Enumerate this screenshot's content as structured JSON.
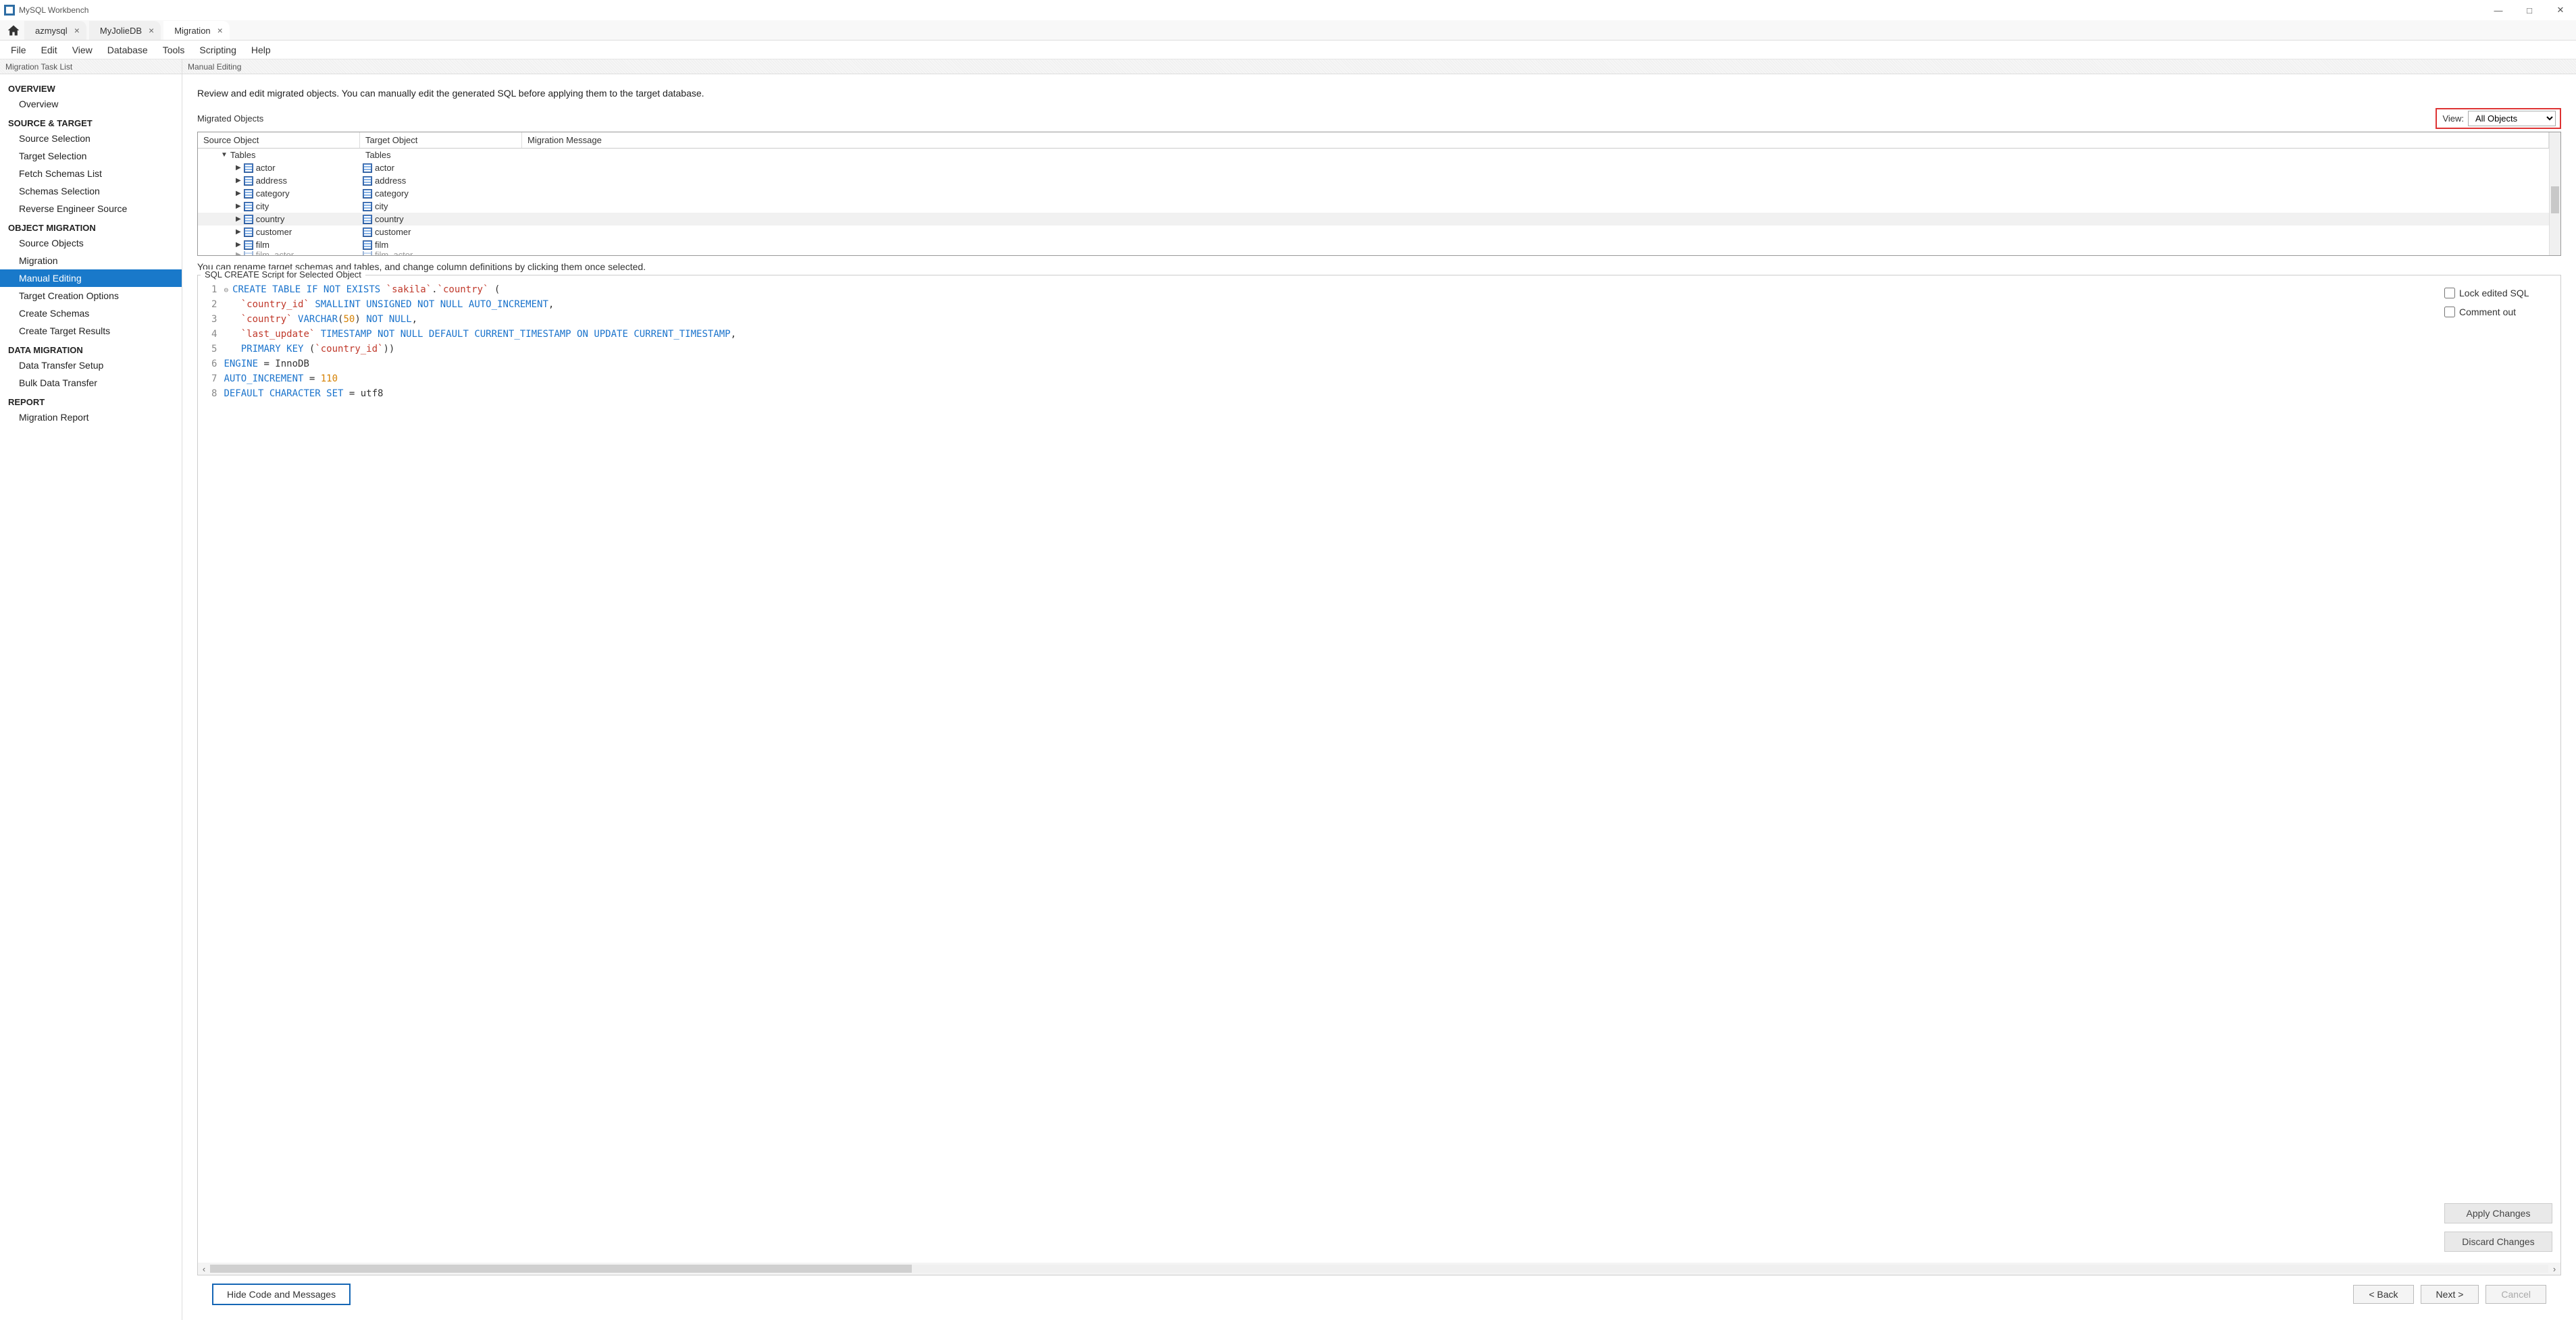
{
  "app": {
    "title": "MySQL Workbench"
  },
  "tabs": [
    {
      "label": "azmysql",
      "active": false
    },
    {
      "label": "MyJolieDB",
      "active": false
    },
    {
      "label": "Migration",
      "active": true
    }
  ],
  "menu": [
    "File",
    "Edit",
    "View",
    "Database",
    "Tools",
    "Scripting",
    "Help"
  ],
  "sidebar": {
    "header": "Migration Task List",
    "sections": [
      {
        "title": "OVERVIEW",
        "items": [
          "Overview"
        ]
      },
      {
        "title": "SOURCE & TARGET",
        "items": [
          "Source Selection",
          "Target Selection",
          "Fetch Schemas List",
          "Schemas Selection",
          "Reverse Engineer Source"
        ]
      },
      {
        "title": "OBJECT MIGRATION",
        "items": [
          "Source Objects",
          "Migration",
          "Manual Editing",
          "Target Creation Options",
          "Create Schemas",
          "Create Target Results"
        ]
      },
      {
        "title": "DATA MIGRATION",
        "items": [
          "Data Transfer Setup",
          "Bulk Data Transfer"
        ]
      },
      {
        "title": "REPORT",
        "items": [
          "Migration Report"
        ]
      }
    ],
    "active": "Manual Editing"
  },
  "main": {
    "header": "Manual Editing",
    "instructions": "Review and edit migrated objects. You can manually edit the generated SQL before applying them to the target database.",
    "migrated_label": "Migrated Objects",
    "view_label": "View:",
    "view_value": "All Objects",
    "columns": {
      "src": "Source Object",
      "tgt": "Target Object",
      "msg": "Migration Message"
    },
    "group": {
      "src": "Tables",
      "tgt": "Tables"
    },
    "rows": [
      {
        "src": "actor",
        "tgt": "actor"
      },
      {
        "src": "address",
        "tgt": "address"
      },
      {
        "src": "category",
        "tgt": "category"
      },
      {
        "src": "city",
        "tgt": "city"
      },
      {
        "src": "country",
        "tgt": "country",
        "selected": true
      },
      {
        "src": "customer",
        "tgt": "customer"
      },
      {
        "src": "film",
        "tgt": "film"
      },
      {
        "src": "film_actor",
        "tgt": "film_actor"
      }
    ],
    "hint": "You can rename target schemas and tables, and change column definitions by clicking them once selected.",
    "sql_title": "SQL CREATE Script for Selected Object",
    "lock_label": "Lock edited SQL",
    "comment_label": "Comment out",
    "apply": "Apply Changes",
    "discard": "Discard Changes",
    "toggle": "Hide Code and Messages",
    "back": "< Back",
    "next": "Next >",
    "cancel": "Cancel"
  },
  "sql": {
    "l1a": "CREATE TABLE IF NOT EXISTS",
    "l1b": "`sakila`",
    "l1c": ".",
    "l1d": "`country`",
    "l1e": " (",
    "l2a": "`country_id`",
    "l2b": " SMALLINT UNSIGNED NOT NULL AUTO_INCREMENT",
    "l2c": ",",
    "l3a": "`country`",
    "l3b": " VARCHAR",
    "l3c": "(",
    "l3d": "50",
    "l3e": ")",
    "l3f": " NOT NULL",
    "l3g": ",",
    "l4a": "`last_update`",
    "l4b": " TIMESTAMP NOT NULL DEFAULT CURRENT_TIMESTAMP ON UPDATE CURRENT_TIMESTAMP",
    "l4c": ",",
    "l5a": "PRIMARY KEY",
    "l5b": " (",
    "l5c": "`country_id`",
    "l5d": "))",
    "l6a": "ENGINE",
    "l6b": " = InnoDB",
    "l7a": "AUTO_INCREMENT",
    "l7b": " = ",
    "l7c": "110",
    "l8a": "DEFAULT CHARACTER SET",
    "l8b": " = utf8"
  }
}
